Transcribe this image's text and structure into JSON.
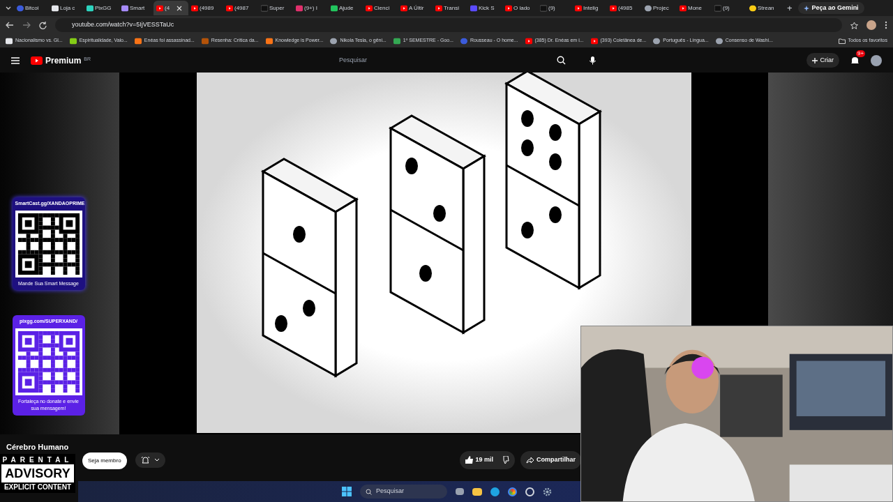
{
  "browser": {
    "tabs": [
      {
        "label": "Bitcoi",
        "kind": "coin",
        "selected": false
      },
      {
        "label": "Loja c",
        "kind": "page",
        "selected": false
      },
      {
        "label": "PixGG",
        "kind": "pix",
        "selected": false
      },
      {
        "label": "Smart",
        "kind": "smart",
        "selected": false
      },
      {
        "label": "(4",
        "kind": "youtube",
        "selected": true
      },
      {
        "label": "(4989",
        "kind": "youtube",
        "selected": false
      },
      {
        "label": "(4987",
        "kind": "youtube",
        "selected": false
      },
      {
        "label": "Super",
        "kind": "tiktok",
        "selected": false
      },
      {
        "label": "(9+) I",
        "kind": "instagram",
        "selected": false
      },
      {
        "label": "Ajude",
        "kind": "check",
        "selected": false
      },
      {
        "label": "Cienci",
        "kind": "youtube",
        "selected": false
      },
      {
        "label": "A Últir",
        "kind": "youtube",
        "selected": false
      },
      {
        "label": "Transi",
        "kind": "youtube",
        "selected": false
      },
      {
        "label": "Kick S",
        "kind": "kick",
        "selected": false
      },
      {
        "label": "O lado",
        "kind": "youtube",
        "selected": false
      },
      {
        "label": "(9)",
        "kind": "tiktok",
        "selected": false
      },
      {
        "label": "Intelig",
        "kind": "youtube",
        "selected": false
      },
      {
        "label": "(4985",
        "kind": "youtube",
        "selected": false
      },
      {
        "label": "Projec",
        "kind": "globe",
        "selected": false
      },
      {
        "label": "Mone",
        "kind": "youtube",
        "selected": false
      },
      {
        "label": "(9)",
        "kind": "tiktok",
        "selected": false
      },
      {
        "label": "Strean",
        "kind": "alert",
        "selected": false
      }
    ],
    "new_tab": "+",
    "gemini": "Peça ao Gemini",
    "url": "youtube.com/watch?v=5IjVESSTaUc",
    "bookmarks": [
      {
        "label": "Nacionalismo vs. Gl...",
        "kind": "page"
      },
      {
        "label": "Espiritualidade, Valo...",
        "kind": "leaf"
      },
      {
        "label": "Enéas foi assassinad...",
        "kind": "blogger"
      },
      {
        "label": "Resenha: Crítica da...",
        "kind": "book"
      },
      {
        "label": "Knowledge is Power...",
        "kind": "blogger"
      },
      {
        "label": "Nikola Tesla, o gêni...",
        "kind": "globe"
      },
      {
        "label": "1º SEMESTRE - Goo...",
        "kind": "drive"
      },
      {
        "label": "Rousseau - O home...",
        "kind": "coin"
      },
      {
        "label": "(385) Dr. Enéas em i...",
        "kind": "youtube"
      },
      {
        "label": "(393) Coletânea de...",
        "kind": "youtube"
      },
      {
        "label": "Português - Língua...",
        "kind": "globe"
      },
      {
        "label": "Consenso de Washi...",
        "kind": "globe"
      }
    ],
    "all_bookmarks": "Todos os favoritos"
  },
  "youtube": {
    "logo": "Premium",
    "region": "BR",
    "search_placeholder": "Pesquisar",
    "create": "Criar",
    "notifications": "9+",
    "channel": "Cérebro Humano",
    "join": "Seja membro",
    "likes": "19 mil",
    "share": "Compartilhar"
  },
  "overlays": [
    {
      "kind": "smartcast",
      "title": "SmartCast.gg/XANDAOPRIME",
      "caption": "Mande Sua Smart Message"
    },
    {
      "kind": "pixgg",
      "title": "pixgg.com/SUPERXAND/",
      "caption": "Fortaleça no donate e envie sua mensagem!"
    }
  ],
  "advisory": [
    "PARENTAL",
    "ADVISORY",
    "EXPLICIT CONTENT"
  ],
  "taskbar": {
    "search_placeholder": "Pesquisar"
  }
}
